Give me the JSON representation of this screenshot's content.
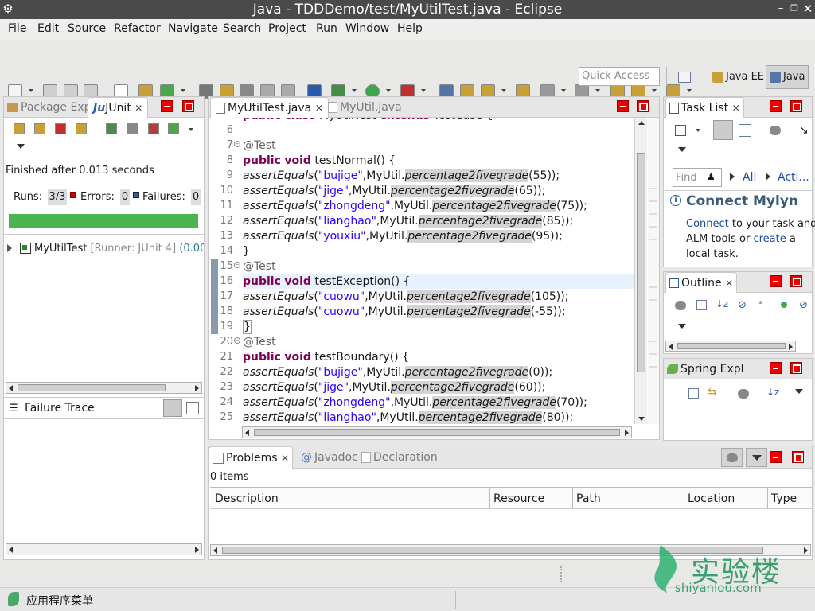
{
  "window": {
    "title": "Java - TDDDemo/test/MyUtilTest.java - Eclipse"
  },
  "menu": [
    {
      "label": "File",
      "u": "F",
      "rest": "ile"
    },
    {
      "label": "Edit",
      "u": "E",
      "rest": "dit"
    },
    {
      "label": "Source",
      "u": "S",
      "rest": "ource"
    },
    {
      "label": "Refactor",
      "pre": "Refac",
      "u": "t",
      "rest": "or"
    },
    {
      "label": "Navigate",
      "u": "N",
      "rest": "avigate"
    },
    {
      "label": "Search",
      "pre": "Se",
      "u": "a",
      "rest": "rch"
    },
    {
      "label": "Project",
      "u": "P",
      "rest": "roject"
    },
    {
      "label": "Run",
      "u": "R",
      "rest": "un"
    },
    {
      "label": "Window",
      "u": "W",
      "rest": "indow"
    },
    {
      "label": "Help",
      "u": "H",
      "rest": "elp"
    }
  ],
  "quick_access": {
    "placeholder": "Quick Access"
  },
  "perspectives": {
    "java_ee": "Java EE",
    "java": "Java"
  },
  "left_panel": {
    "tab_package": "Package Exp",
    "tab_junit": "JUnit",
    "status": "Finished after 0.013 seconds",
    "runs_label": "Runs:",
    "runs_value": "3/3",
    "errors_label": "Errors:",
    "errors_value": "0",
    "failures_label": "Failures:",
    "failures_value": "0",
    "progress": 1.0,
    "tree_item": "MyUtilTest",
    "tree_runner": "[Runner: JUnit 4]",
    "tree_time": "(0.00",
    "failure_trace": "Failure Trace"
  },
  "editor": {
    "tab_active": "MyUtilTest.java",
    "tab_other": "MyUtil.java",
    "top_partial": "public class MyUtilTest extends TestCase {",
    "lines": [
      {
        "n": "6",
        "kind": "blank"
      },
      {
        "n": "7",
        "kind": "ann",
        "text": "@Test",
        "fold": true
      },
      {
        "n": "8",
        "kind": "method",
        "name": "testNormal"
      },
      {
        "n": "9",
        "kind": "assert",
        "s": "\"bujige\"",
        "arg": "55"
      },
      {
        "n": "10",
        "kind": "assert",
        "s": "\"jige\"",
        "arg": "65"
      },
      {
        "n": "11",
        "kind": "assert",
        "s": "\"zhongdeng\"",
        "arg": "75"
      },
      {
        "n": "12",
        "kind": "assert",
        "s": "\"lianghao\"",
        "arg": "85"
      },
      {
        "n": "13",
        "kind": "assert",
        "s": "\"youxiu\"",
        "arg": "95"
      },
      {
        "n": "14",
        "kind": "close"
      },
      {
        "n": "15",
        "kind": "ann",
        "text": "@Test",
        "fold": true
      },
      {
        "n": "16",
        "kind": "method",
        "name": "testException"
      },
      {
        "n": "17",
        "kind": "assert",
        "s": "\"cuowu\"",
        "arg": "105"
      },
      {
        "n": "18",
        "kind": "assert",
        "s": "\"cuowu\"",
        "arg": "-55"
      },
      {
        "n": "19",
        "kind": "close"
      },
      {
        "n": "20",
        "kind": "ann",
        "text": "@Test",
        "fold": true
      },
      {
        "n": "21",
        "kind": "method",
        "name": "testBoundary"
      },
      {
        "n": "22",
        "kind": "assert",
        "s": "\"bujige\"",
        "arg": "0"
      },
      {
        "n": "23",
        "kind": "assert",
        "s": "\"jige\"",
        "arg": "60"
      },
      {
        "n": "24",
        "kind": "assert",
        "s": "\"zhongdeng\"",
        "arg": "70"
      },
      {
        "n": "25",
        "kind": "assert",
        "s": "\"lianghao\"",
        "arg": "80"
      }
    ],
    "tokens": {
      "public": "public",
      "void": "void",
      "paren": "() {",
      "assert": "assertEquals",
      "myutil": "MyUtil.",
      "method": "percentage2fivegrade",
      "close_brace": "}"
    }
  },
  "right_panels": {
    "task_list": "Task List",
    "find_placeholder": "Find",
    "all": "All",
    "acti": "Acti...",
    "mylyn_title": "Connect Mylyn",
    "mylyn_connect": "Connect",
    "mylyn_text1": " to your task and",
    "mylyn_text2": "ALM tools or ",
    "mylyn_create": "create",
    "mylyn_text3": " a",
    "mylyn_text4": "local task.",
    "outline": "Outline",
    "spring": "Spring Expl"
  },
  "bottom_panel": {
    "tab_problems": "Problems",
    "tab_javadoc": "Javadoc",
    "tab_declaration": "Declaration",
    "items": "0 items",
    "columns": [
      "Description",
      "Resource",
      "Path",
      "Location",
      "Type"
    ]
  },
  "statusbar": {
    "app_menu": "应用程序菜单",
    "watermark_cn": "实验楼",
    "watermark_en": "shiyanlou.com"
  }
}
